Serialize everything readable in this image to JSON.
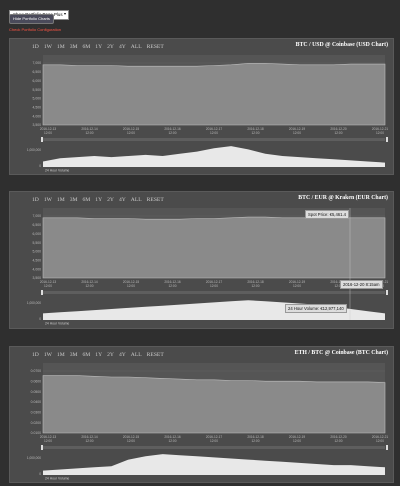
{
  "controls": {
    "select_label": "Show Portfolio Page Plus",
    "button_label": "Hide Portfolio Charts",
    "warning_text": "Check Portfolio Configuration"
  },
  "range_buttons": [
    "1D",
    "1W",
    "1M",
    "3M",
    "6M",
    "1Y",
    "2Y",
    "4Y",
    "ALL",
    "RESET"
  ],
  "charts": [
    {
      "title": "BTC / USD @ Coinbase (USD Chart)",
      "y_ticks": [
        "7,000",
        "6,500",
        "6,000",
        "5,500",
        "5,000",
        "4,500",
        "4,000",
        "3,500"
      ],
      "x_dates": [
        "2016-12-13",
        "2016-12-14",
        "2016-12-15",
        "2016-12-16",
        "2016-12-17",
        "2016-12-18",
        "2016-12-19",
        "2016-12-20",
        "2016-12-21"
      ],
      "x_times": [
        "12:00",
        "12:00",
        "12:00",
        "12:00",
        "12:00",
        "12:00",
        "12:00",
        "12:00",
        "12:00"
      ],
      "volume_label": "24 Hour Volume",
      "volume_ticks": [
        "1,000,000",
        "0"
      ],
      "tooltips": []
    },
    {
      "title": "BTC / EUR @ Kraken (EUR Chart)",
      "y_ticks": [
        "7,000",
        "6,500",
        "6,000",
        "5,500",
        "5,000",
        "4,500",
        "4,000",
        "3,500"
      ],
      "x_dates": [
        "2016-12-13",
        "2016-12-14",
        "2016-12-15",
        "2016-12-16",
        "2016-12-17",
        "2016-12-18",
        "2016-12-19",
        "2016-12-20",
        "2016-12-21"
      ],
      "x_times": [
        "12:00",
        "12:00",
        "12:00",
        "12:00",
        "12:00",
        "12:00",
        "12:00",
        "12:00",
        "12:00"
      ],
      "volume_label": "24 Hour Volume",
      "volume_ticks": [
        "1,000,000",
        "0"
      ],
      "tooltips": [
        "Spot Price: €5,461.4",
        "2016-12-20 8:15am",
        "24 Hour Volume: €12,977,140"
      ]
    },
    {
      "title": "ETH / BTC @ Coinbase (BTC Chart)",
      "y_ticks": [
        "0.0700",
        "0.0600",
        "0.0500",
        "0.0400",
        "0.0300",
        "0.0200",
        "0.0100"
      ],
      "x_dates": [
        "2016-12-13",
        "2016-12-14",
        "2016-12-15",
        "2016-12-16",
        "2016-12-17",
        "2016-12-18",
        "2016-12-19",
        "2016-12-20",
        "2016-12-21"
      ],
      "x_times": [
        "12:00",
        "12:00",
        "12:00",
        "12:00",
        "12:00",
        "12:00",
        "12:00",
        "12:00",
        "12:00"
      ],
      "volume_label": "24 Hour Volume",
      "volume_ticks": [
        "1,000,000",
        "0"
      ],
      "tooltips": []
    }
  ],
  "colors": {
    "area_fill": "#8a8a8a",
    "area_line": "#bdbdbd",
    "volume_fill": "#e8e8e8",
    "warning": "#ff5544"
  }
}
